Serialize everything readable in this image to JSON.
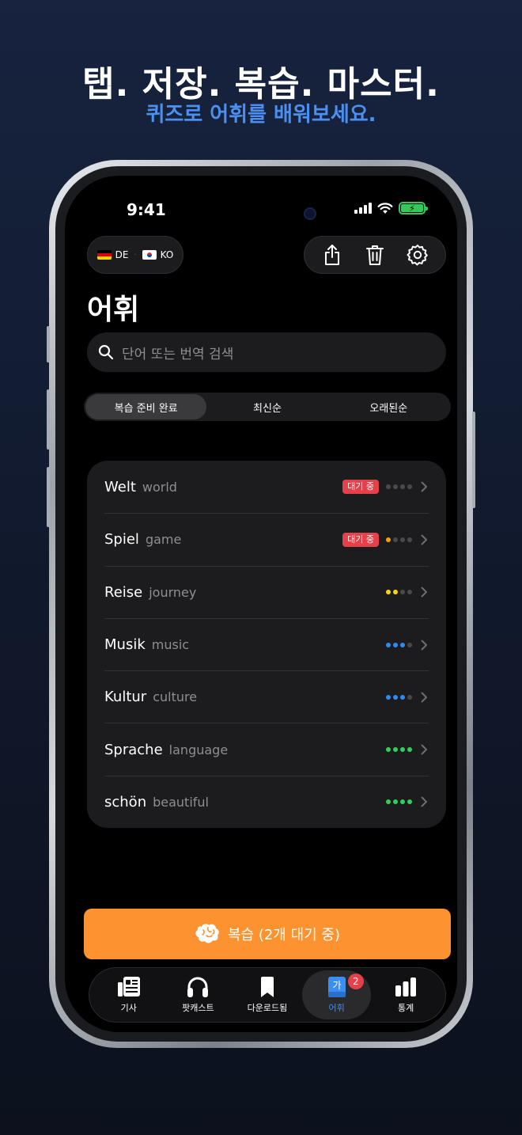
{
  "marketing": {
    "headline": "탭. 저장. 복습. 마스터.",
    "subheadline": "퀴즈로 어휘를 배워보세요."
  },
  "status_bar": {
    "time": "9:41"
  },
  "language": {
    "source_code": "DE",
    "target_code": "KO",
    "separator": "·"
  },
  "header": {
    "title": "어휘"
  },
  "search": {
    "placeholder": "단어 또는 번역 검색"
  },
  "sort_tabs": [
    {
      "label": "복습 준비 완료",
      "active": true
    },
    {
      "label": "최신순",
      "active": false
    },
    {
      "label": "오래된순",
      "active": false
    }
  ],
  "vocab": [
    {
      "term": "Welt",
      "translation": "world",
      "badge": "대기 중",
      "progress": 0,
      "level_color": "#4a4a4d"
    },
    {
      "term": "Spiel",
      "translation": "game",
      "badge": "대기 중",
      "progress": 1,
      "level_color": "#ff9f0a"
    },
    {
      "term": "Reise",
      "translation": "journey",
      "badge": "",
      "progress": 2,
      "level_color": "#ffd60a"
    },
    {
      "term": "Musik",
      "translation": "music",
      "badge": "",
      "progress": 3,
      "level_color": "#2f8cf5"
    },
    {
      "term": "Kultur",
      "translation": "culture",
      "badge": "",
      "progress": 3,
      "level_color": "#2f8cf5"
    },
    {
      "term": "Sprache",
      "translation": "language",
      "badge": "",
      "progress": 4,
      "level_color": "#30d158"
    },
    {
      "term": "schön",
      "translation": "beautiful",
      "badge": "",
      "progress": 4,
      "level_color": "#30d158"
    }
  ],
  "progress_max": 4,
  "review_button": {
    "label": "복습 (2개 대기 중)",
    "icon": "brain-icon",
    "color": "#fd9330"
  },
  "tabbar": [
    {
      "label": "기사",
      "icon": "article-icon",
      "active": false
    },
    {
      "label": "팟캐스트",
      "icon": "headphones-icon",
      "active": false
    },
    {
      "label": "다운로드됨",
      "icon": "bookmark-icon",
      "active": false
    },
    {
      "label": "어휘",
      "icon": "vocabulary-book-icon",
      "active": true,
      "badge": "2",
      "glyph": "가"
    },
    {
      "label": "통계",
      "icon": "bar-chart-icon",
      "active": false
    }
  ],
  "colors": {
    "accent": "#3b8ff3",
    "warning_badge": "#e5414a",
    "review_orange": "#fd9330"
  }
}
